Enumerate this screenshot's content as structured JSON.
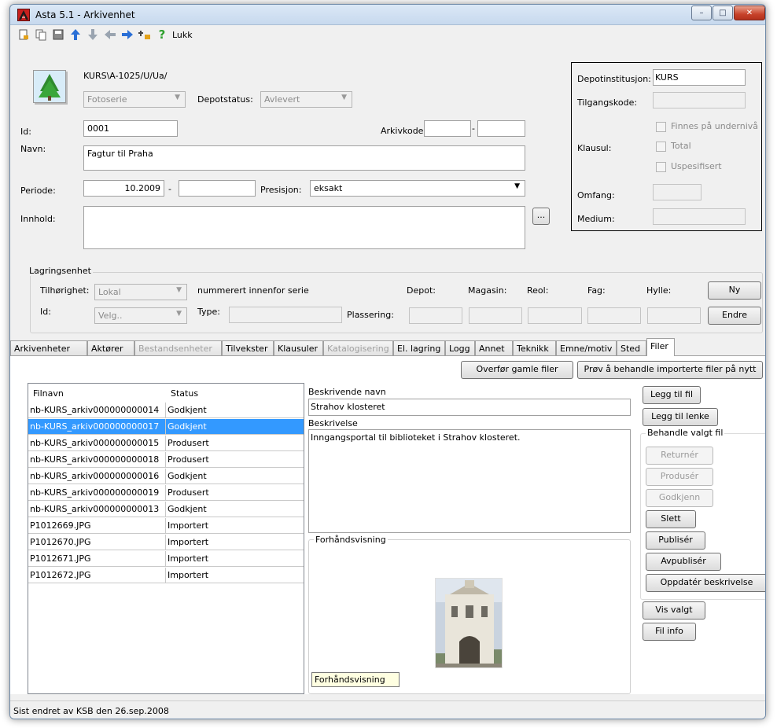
{
  "window": {
    "title": "Asta 5.1 - Arkivenhet",
    "minimize": "–",
    "maximize": "□",
    "close": "✕"
  },
  "toolbar": {
    "close_label": "Lukk"
  },
  "header": {
    "code": "KURS\\A-1025/U/Ua/",
    "type_select": "Fotoserie",
    "depotstatus_label": "Depotstatus:",
    "depotstatus_value": "Avlevert",
    "id_label": "Id:",
    "id_value": "0001",
    "arkivkode_label": "Arkivkode:",
    "arkivkode_dash": "-",
    "navn_label": "Navn:",
    "navn_value": "Fagtur til Praha",
    "periode_label": "Periode:",
    "periode_from": "10.2009",
    "periode_dash": "-",
    "presisjon_label": "Presisjon:",
    "presisjon_value": "eksakt",
    "innhold_label": "Innhold:",
    "ellipsis": "..."
  },
  "depot": {
    "institusjon_label": "Depotinstitusjon:",
    "institusjon_value": "KURS",
    "tilgangskode_label": "Tilgangskode:",
    "klausul_label": "Klausul:",
    "finnes_label": "Finnes på undernivå",
    "total_label": "Total",
    "uspesifisert_label": "Uspesifisert",
    "omfang_label": "Omfang:",
    "medium_label": "Medium:"
  },
  "lagring": {
    "title": "Lagringsenhet",
    "tilhorighet_label": "Tilhørighet:",
    "tilhorighet_value": "Lokal",
    "nummerert_label": "nummerert innenfor serie",
    "id_label": "Id:",
    "id_value": "Velg..",
    "type_label": "Type:",
    "depot_label": "Depot:",
    "magasin_label": "Magasin:",
    "reol_label": "Reol:",
    "fag_label": "Fag:",
    "hylle_label": "Hylle:",
    "plassering_label": "Plassering:",
    "ny_button": "Ny",
    "endre_button": "Endre"
  },
  "tabs": [
    {
      "label": "Arkivenheter",
      "disabled": false
    },
    {
      "label": "Aktører",
      "disabled": false
    },
    {
      "label": "Bestandsenheter",
      "disabled": true
    },
    {
      "label": "Tilvekster",
      "disabled": false
    },
    {
      "label": "Klausuler",
      "disabled": false
    },
    {
      "label": "Katalogisering",
      "disabled": true
    },
    {
      "label": "El. lagring",
      "disabled": false
    },
    {
      "label": "Logg",
      "disabled": false
    },
    {
      "label": "Annet",
      "disabled": false
    },
    {
      "label": "Teknikk",
      "disabled": false
    },
    {
      "label": "Emne/motiv",
      "disabled": false
    },
    {
      "label": "Sted",
      "disabled": false
    },
    {
      "label": "Filer",
      "disabled": false,
      "active": true
    }
  ],
  "files_panel": {
    "overfor_button": "Overfør gamle filer",
    "prov_button": "Prøv å behandle importerte filer på nytt",
    "columns": [
      "Filnavn",
      "Status"
    ],
    "rows": [
      {
        "name": "nb-KURS_arkiv000000000014",
        "status": "Godkjent",
        "selected": false
      },
      {
        "name": "nb-KURS_arkiv000000000017",
        "status": "Godkjent",
        "selected": true
      },
      {
        "name": "nb-KURS_arkiv000000000015",
        "status": "Produsert",
        "selected": false
      },
      {
        "name": "nb-KURS_arkiv000000000018",
        "status": "Produsert",
        "selected": false
      },
      {
        "name": "nb-KURS_arkiv000000000016",
        "status": "Godkjent",
        "selected": false
      },
      {
        "name": "nb-KURS_arkiv000000000019",
        "status": "Produsert",
        "selected": false
      },
      {
        "name": "nb-KURS_arkiv000000000013",
        "status": "Godkjent",
        "selected": false
      },
      {
        "name": "P1012669.JPG",
        "status": "Importert",
        "selected": false
      },
      {
        "name": "P1012670.JPG",
        "status": "Importert",
        "selected": false
      },
      {
        "name": "P1012671.JPG",
        "status": "Importert",
        "selected": false
      },
      {
        "name": "P1012672.JPG",
        "status": "Importert",
        "selected": false
      }
    ],
    "beskrivende_navn_label": "Beskrivende navn",
    "beskrivende_navn_value": "Strahov klosteret",
    "beskrivelse_label": "Beskrivelse",
    "beskrivelse_value": "Inngangsportal til biblioteket i Strahov klosteret.",
    "forhandsvisning_label": "Forhåndsvisning",
    "forhandsvisning_tooltip": "Forhåndsvisning",
    "legg_til_fil": "Legg til fil",
    "legg_til_lenke": "Legg til lenke",
    "behandle_title": "Behandle valgt fil",
    "returner": "Returnér",
    "produser": "Produsér",
    "godkjenn": "Godkjenn",
    "slett": "Slett",
    "publiser": "Publisér",
    "avpubliser": "Avpublisér",
    "oppdater": "Oppdatér beskrivelse",
    "vis_valgt": "Vis valgt",
    "fil_info": "Fil info"
  },
  "statusbar": {
    "text": "Sist endret av KSB den 26.sep.2008"
  }
}
